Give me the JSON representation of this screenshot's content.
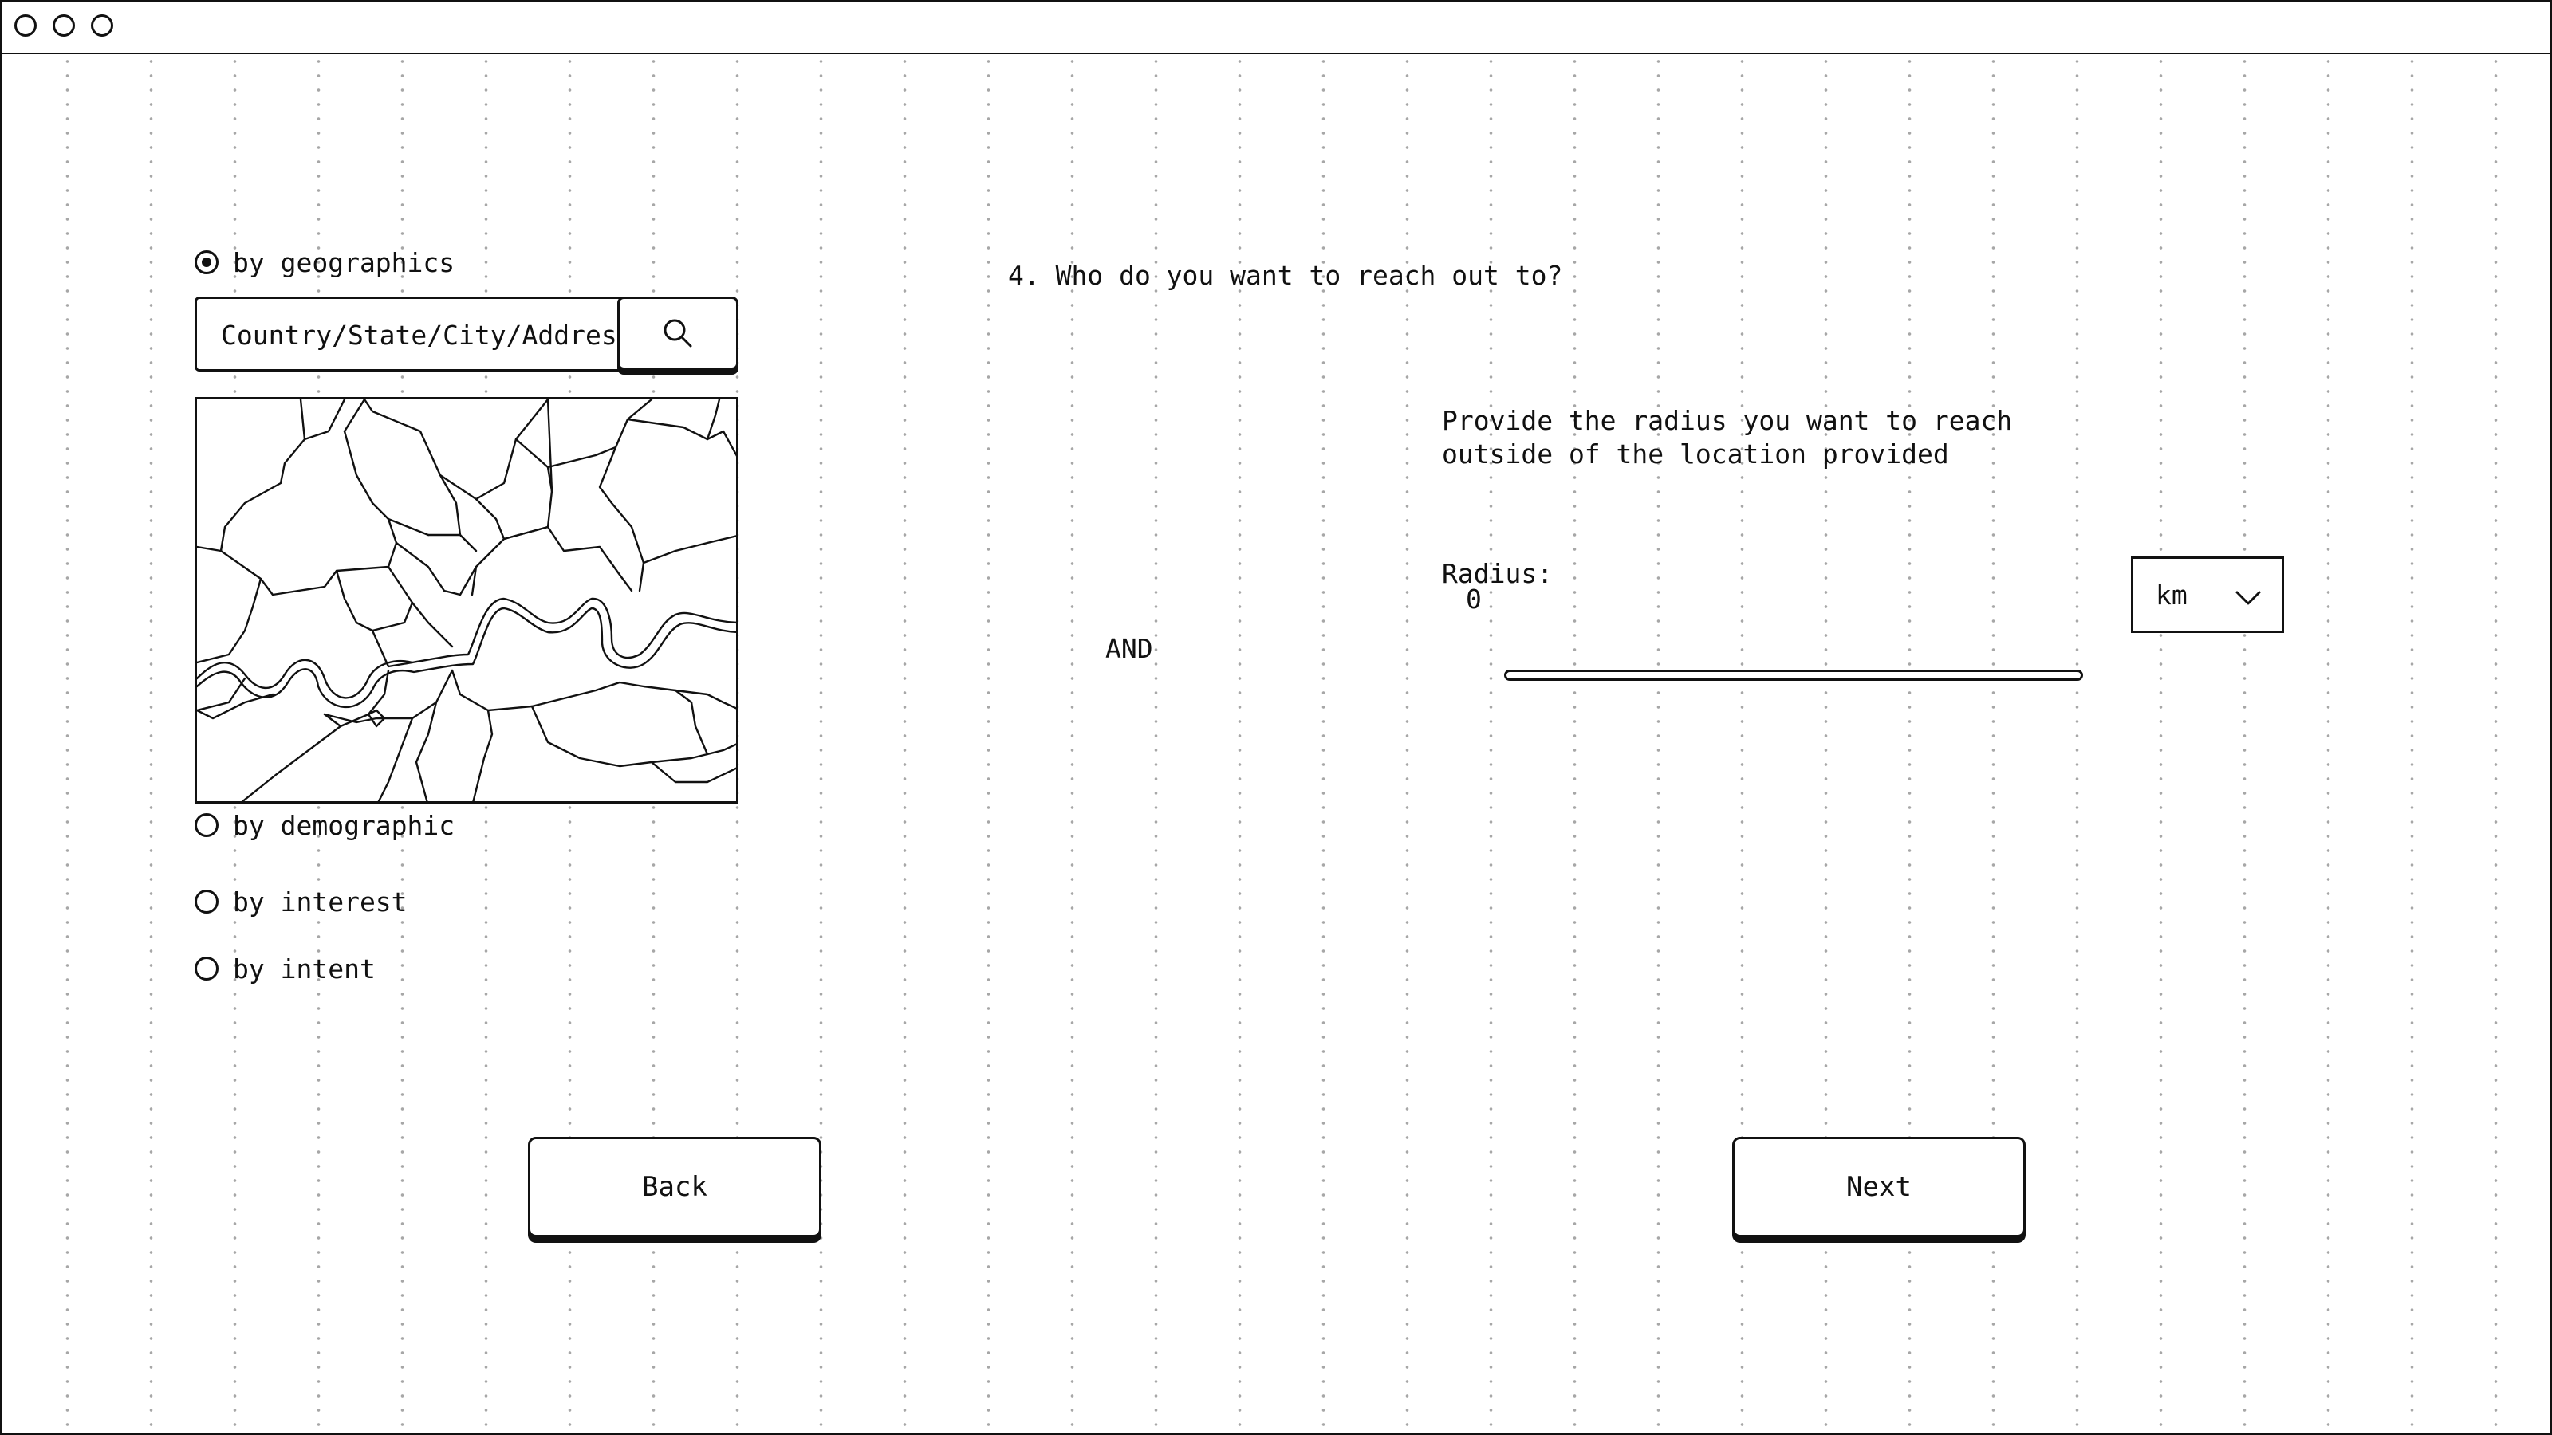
{
  "question": {
    "title": "4. Who do you want to reach out to?"
  },
  "targeting": {
    "options": [
      {
        "label": "by geographics",
        "checked": true
      },
      {
        "label": "by demographic",
        "checked": false
      },
      {
        "label": "by interest",
        "checked": false
      },
      {
        "label": "by intent",
        "checked": false
      }
    ],
    "search": {
      "value": "Country/State/City/Address",
      "icon": "search-icon"
    }
  },
  "conjunction": "AND",
  "radius": {
    "instruction_line1": "Provide the radius you want to reach",
    "instruction_line2": "outside of the location provided",
    "label": "Radius:",
    "value": "0",
    "unit": "km",
    "unit_icon": "chevron-down-icon"
  },
  "navigation": {
    "back_label": "Back",
    "next_label": "Next"
  },
  "colors": {
    "ink": "#111111",
    "background": "#ffffff",
    "grid_dots": "#8a8a8a"
  }
}
